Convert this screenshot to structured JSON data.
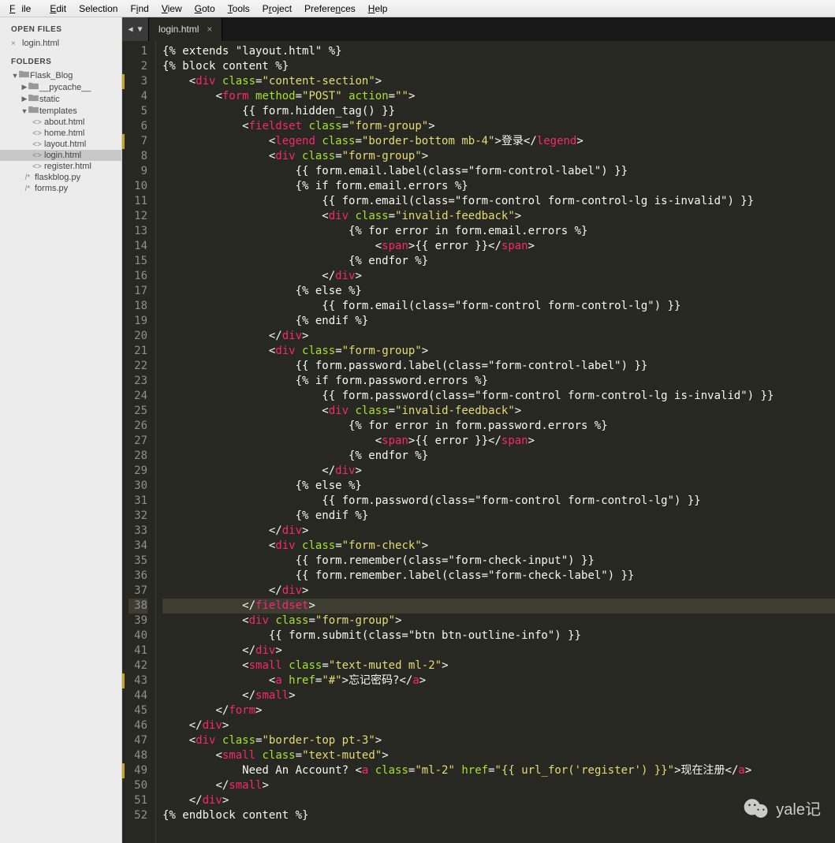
{
  "menu": {
    "file": "File",
    "edit": "Edit",
    "selection": "Selection",
    "find": "Find",
    "view": "View",
    "goto": "Goto",
    "tools": "Tools",
    "project": "Project",
    "preferences": "Preferences",
    "help": "Help"
  },
  "sidebar": {
    "open_files_title": "OPEN FILES",
    "open_files": [
      {
        "name": "login.html"
      }
    ],
    "folders_title": "FOLDERS",
    "tree": {
      "root": "Flask_Blog",
      "pycache": "__pycache__",
      "static": "static",
      "templates": "templates",
      "files_templates": [
        "about.html",
        "home.html",
        "layout.html",
        "login.html",
        "register.html"
      ],
      "files_root": [
        "flaskblog.py",
        "forms.py"
      ]
    }
  },
  "tab": {
    "name": "login.html"
  },
  "cursor_line": 38,
  "code_lines": [
    "{% extends \"layout.html\" %}",
    "{% block content %}",
    "    <div class=\"content-section\">",
    "        <form method=\"POST\" action=\"\">",
    "            {{ form.hidden_tag() }}",
    "            <fieldset class=\"form-group\">",
    "                <legend class=\"border-bottom mb-4\">登录</legend>",
    "                <div class=\"form-group\">",
    "                    {{ form.email.label(class=\"form-control-label\") }}",
    "                    {% if form.email.errors %}",
    "                        {{ form.email(class=\"form-control form-control-lg is-invalid\") }}",
    "                        <div class=\"invalid-feedback\">",
    "                            {% for error in form.email.errors %}",
    "                                <span>{{ error }}</span>",
    "                            {% endfor %}",
    "                        </div>",
    "                    {% else %}",
    "                        {{ form.email(class=\"form-control form-control-lg\") }}",
    "                    {% endif %}",
    "                </div>",
    "                <div class=\"form-group\">",
    "                    {{ form.password.label(class=\"form-control-label\") }}",
    "                    {% if form.password.errors %}",
    "                        {{ form.password(class=\"form-control form-control-lg is-invalid\") }}",
    "                        <div class=\"invalid-feedback\">",
    "                            {% for error in form.password.errors %}",
    "                                <span>{{ error }}</span>",
    "                            {% endfor %}",
    "                        </div>",
    "                    {% else %}",
    "                        {{ form.password(class=\"form-control form-control-lg\") }}",
    "                    {% endif %}",
    "                </div>",
    "                <div class=\"form-check\">",
    "                    {{ form.remember(class=\"form-check-input\") }}",
    "                    {{ form.remember.label(class=\"form-check-label\") }}",
    "                </div>",
    "            </fieldset>",
    "            <div class=\"form-group\">",
    "                {{ form.submit(class=\"btn btn-outline-info\") }}",
    "            </div>",
    "            <small class=\"text-muted ml-2\">",
    "                <a href=\"#\">忘记密码?</a>",
    "            </small>",
    "        </form>",
    "    </div>",
    "    <div class=\"border-top pt-3\">",
    "        <small class=\"text-muted\">",
    "            Need An Account? <a class=\"ml-2\" href=\"{{ url_for('register') }}\">现在注册</a>",
    "        </small>",
    "    </div>",
    "{% endblock content %}"
  ],
  "line_markers": [
    3,
    7,
    43,
    49
  ],
  "watermark": "yale记"
}
